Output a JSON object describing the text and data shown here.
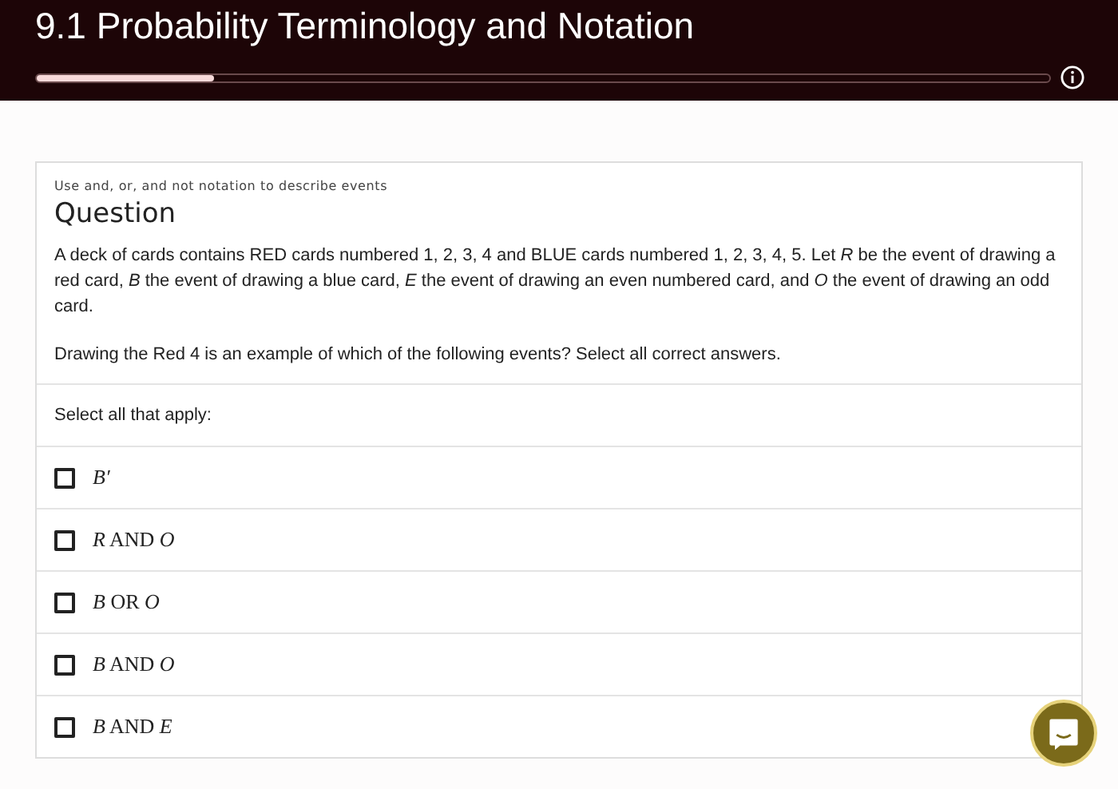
{
  "header": {
    "title": "9.1 Probability Terminology and Notation",
    "progress": {
      "level": 0.175
    }
  },
  "question": {
    "topic": "Use and, or, and not notation to describe events",
    "heading": "Question",
    "paragraphs": [
      "A deck of cards contains RED cards numbered 1, 2, 3, 4 and BLUE cards numbered 1, 2, 3, 4, 5. Let *R* be the event of drawing a red card, *B* the event of drawing a blue card, *E* the event of drawing an even numbered card, and *O* the event of drawing an odd card.",
      "Drawing the Red 4 is an example of which of the following events? Select all correct answers."
    ],
    "instruction": "Select all that apply:",
    "options": [
      {
        "label": "*B′*",
        "checked": false
      },
      {
        "label": "*R* AND *O*",
        "checked": false
      },
      {
        "label": "*B* OR *O*",
        "checked": false
      },
      {
        "label": "*B* AND *O*",
        "checked": false
      },
      {
        "label": "*B* AND *E*",
        "checked": false
      }
    ]
  }
}
